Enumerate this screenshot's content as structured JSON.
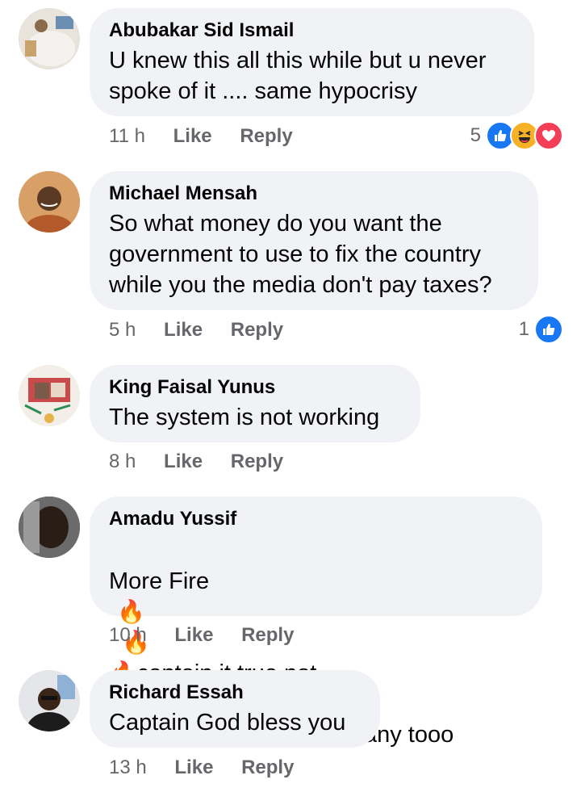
{
  "comments": [
    {
      "name": "Abubakar Sid Ismail",
      "text": "U knew this all this while but u never\nspoke of it .... same hypocrisy",
      "time": "11 h",
      "like": "Like",
      "reply": "Reply",
      "reaction_count": "5",
      "reactions": [
        "like-icon",
        "haha-icon",
        "love-icon"
      ]
    },
    {
      "name": "Michael Mensah",
      "text": "So what money do you want the\ngovernment to use to fix the country\nwhile you the media don't pay taxes?",
      "time": "5 h",
      "like": "Like",
      "reply": "Reply",
      "reaction_count": "1",
      "reactions": [
        "like-icon"
      ]
    },
    {
      "name": "King Faisal Yunus",
      "text": "The system is not working",
      "time": "8 h",
      "like": "Like",
      "reply": "Reply"
    },
    {
      "name": "Amadu Yussif",
      "text_before": "More Fire",
      "text_after": "captain it true not",
      "text_line2": "only the and some company tooo",
      "time": "10 h",
      "like": "Like",
      "reply": "Reply"
    },
    {
      "name": "Richard Essah",
      "text": "Captain God bless you",
      "time": "13 h",
      "like": "Like",
      "reply": "Reply"
    }
  ],
  "colors": {
    "bubble": "#f0f2f5",
    "meta_text": "#65676b",
    "like_blue": "#1877f2",
    "love_red": "#f33e58",
    "haha_yellow": "#f7b125"
  }
}
